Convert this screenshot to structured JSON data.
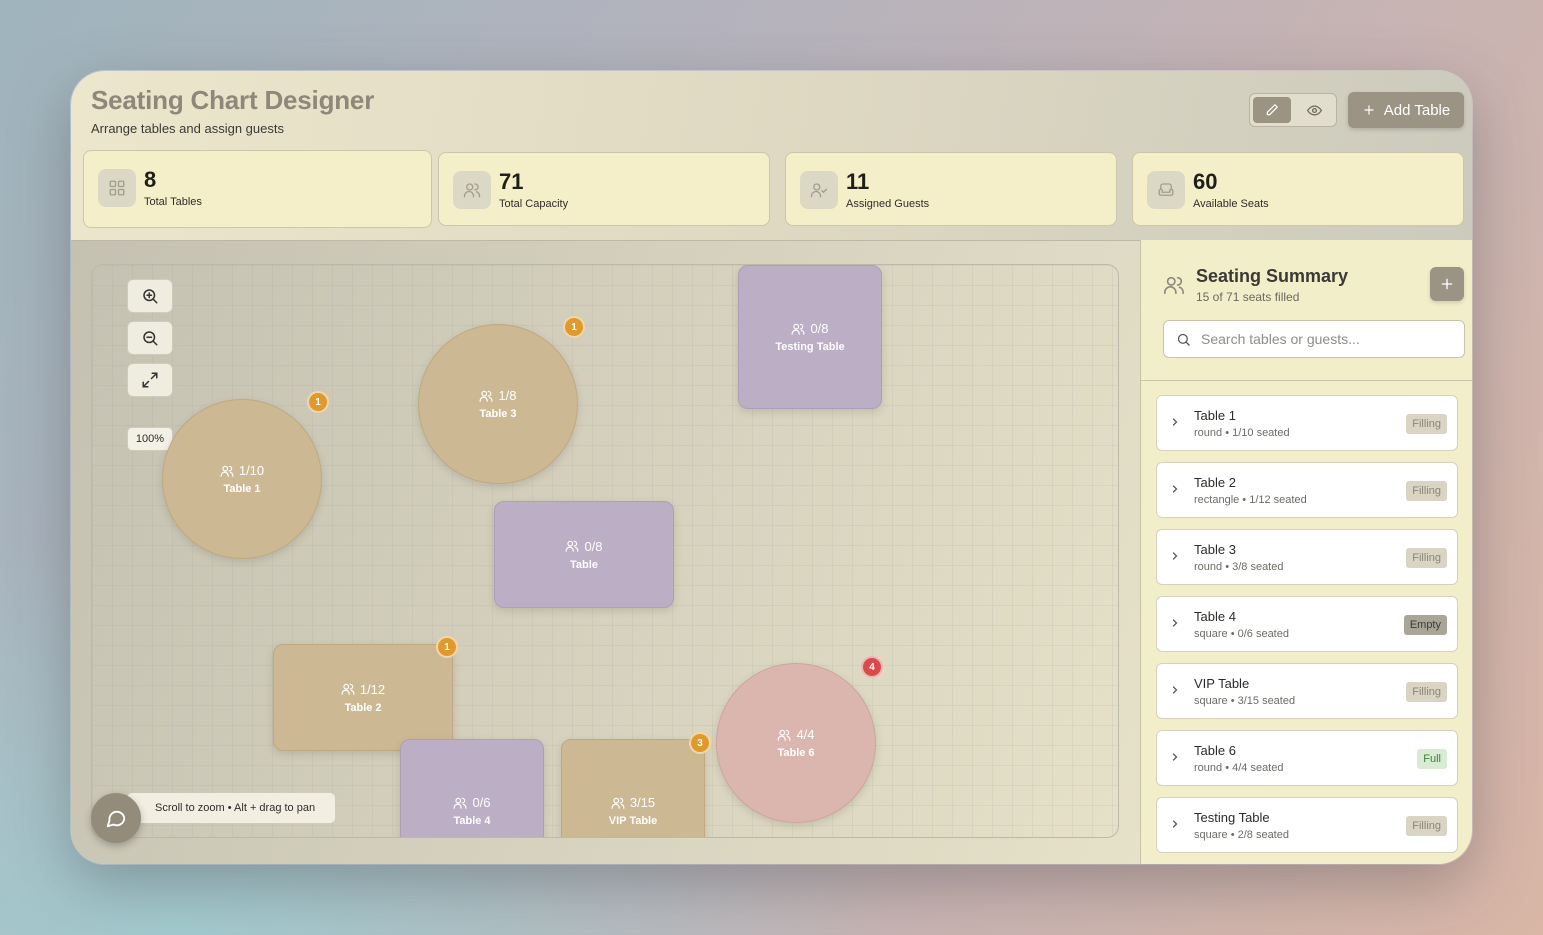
{
  "app": {
    "title": "Seating Chart Designer",
    "subtitle": "Arrange tables and assign guests",
    "add_table_label": "Add Table"
  },
  "stats": [
    {
      "value": "8",
      "label": "Total Tables",
      "icon": "grid-icon"
    },
    {
      "value": "71",
      "label": "Total Capacity",
      "icon": "users-icon"
    },
    {
      "value": "11",
      "label": "Assigned Guests",
      "icon": "user-check-icon"
    },
    {
      "value": "60",
      "label": "Available Seats",
      "icon": "armchair-icon"
    }
  ],
  "canvas": {
    "zoom_level": "100%",
    "hint": "Scroll to zoom • Alt + drag to pan",
    "tables": [
      {
        "name": "Table 1",
        "count": "1/10",
        "badge": "1"
      },
      {
        "name": "Table 3",
        "count": "1/8",
        "badge": "1"
      },
      {
        "name": "Testing Table",
        "count": "0/8",
        "badge": ""
      },
      {
        "name": "Table",
        "count": "0/8",
        "badge": ""
      },
      {
        "name": "Table 2",
        "count": "1/12",
        "badge": "1"
      },
      {
        "name": "Table 6",
        "count": "4/4",
        "badge": "4"
      },
      {
        "name": "Table 4",
        "count": "0/6",
        "badge": ""
      },
      {
        "name": "VIP Table",
        "count": "3/15",
        "badge": "3"
      }
    ]
  },
  "sidebar": {
    "title": "Seating Summary",
    "subtitle": "15 of 71 seats filled",
    "search_placeholder": "Search tables or guests...",
    "items": [
      {
        "name": "Table 1",
        "detail": "round • 1/10 seated",
        "status": "Filling"
      },
      {
        "name": "Table 2",
        "detail": "rectangle • 1/12 seated",
        "status": "Filling"
      },
      {
        "name": "Table 3",
        "detail": "round • 3/8 seated",
        "status": "Filling"
      },
      {
        "name": "Table 4",
        "detail": "square • 0/6 seated",
        "status": "Empty"
      },
      {
        "name": "VIP Table",
        "detail": "square • 3/15 seated",
        "status": "Filling"
      },
      {
        "name": "Table 6",
        "detail": "round • 4/4 seated",
        "status": "Full"
      },
      {
        "name": "Testing Table",
        "detail": "square • 2/8 seated",
        "status": "Filling"
      }
    ]
  },
  "colors": {
    "accent": "#9b9384",
    "badge_orange": "#e09a2c",
    "badge_red": "#d94b4b",
    "table_tan": "#cdb894",
    "table_purple": "#bcaec5",
    "table_pink": "#dab6ae"
  }
}
